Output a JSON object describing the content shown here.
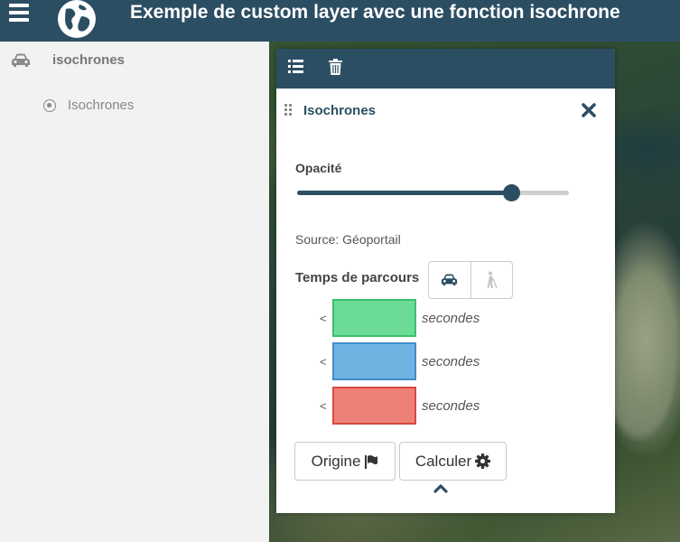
{
  "header": {
    "title": "Exemple de custom layer avec une fonction isochrone",
    "menu_icon": "hamburger-icon",
    "logo_icon": "globe-icon"
  },
  "sidebar": {
    "group": {
      "label": "isochrones",
      "icon": "car-icon"
    },
    "items": [
      {
        "label": "Isochrones",
        "icon": "radio-icon"
      }
    ]
  },
  "panel": {
    "toolbar": {
      "list_icon": "list-icon",
      "trash_icon": "trash-icon"
    },
    "layer": {
      "title": "Isochrones",
      "close_icon": "close-icon",
      "drag_icon": "drag-handle-icon"
    },
    "opacity": {
      "label": "Opacité",
      "value": 0.79
    },
    "source": "Source: Géoportail",
    "travel_time": {
      "label": "Temps de parcours",
      "modes": [
        "car-icon",
        "pedestrian-icon"
      ],
      "selected_mode": "car"
    },
    "ranges": [
      {
        "prefix": "<",
        "unit": "secondes",
        "color": "#6cdb98",
        "border": "#3cc06a"
      },
      {
        "prefix": "<",
        "unit": "secondes",
        "color": "#6fb3e3",
        "border": "#3f8ccc"
      },
      {
        "prefix": "<",
        "unit": "secondes",
        "color": "#ee8177",
        "border": "#d9493e"
      }
    ],
    "buttons": {
      "origin_label": "Origine",
      "origin_icon": "flag-icon",
      "compute_label": "Calculer",
      "compute_icon": "gear-icon"
    },
    "collapse_icon": "chevron-up-icon"
  },
  "colors": {
    "primary": "#2c4e63"
  }
}
